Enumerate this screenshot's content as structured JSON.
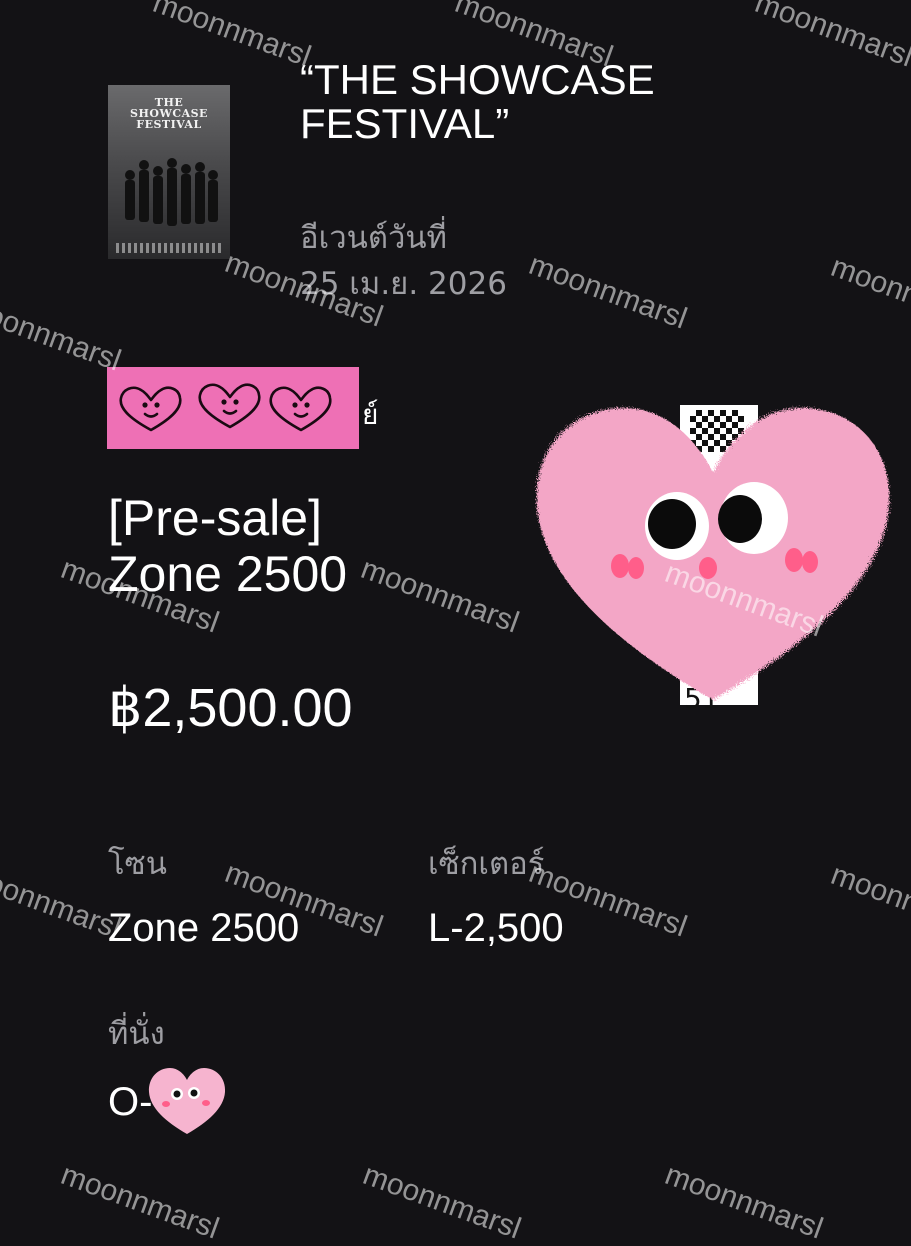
{
  "poster": {
    "title_line1": "THE",
    "title_line2": "SHOWCASE",
    "title_line3": "FESTIVAL"
  },
  "event": {
    "title": "“THE SHOWCASE FESTIVAL”",
    "date_label": "อีเวนต์วันที่",
    "date": "25 เม.ย. 2026"
  },
  "holder": {
    "name_suffix": "ย์"
  },
  "ticket": {
    "name_line1": "[Pre-sale]",
    "name_line2": "Zone 2500",
    "price": "฿2,500.00"
  },
  "details": {
    "zone_label": "โซน",
    "zone_value": "Zone 2500",
    "sector_label": "เซ็กเตอร์",
    "sector_value": "L-2,500",
    "seat_label": "ที่นั่ง",
    "seat_value": "O-"
  },
  "qr": {
    "tail_text": "51"
  },
  "icons": {
    "stickers": [
      "heart-face-icon",
      "pink-heart-sticker-icon",
      "mini-heart-sticker-icon"
    ]
  },
  "colors": {
    "background": "#131215",
    "accent_pink": "#ee70b5",
    "sticker_pink": "#f4a8c8",
    "muted_text": "#9e9ea3"
  },
  "watermark": {
    "text": "moonnmarsl"
  }
}
